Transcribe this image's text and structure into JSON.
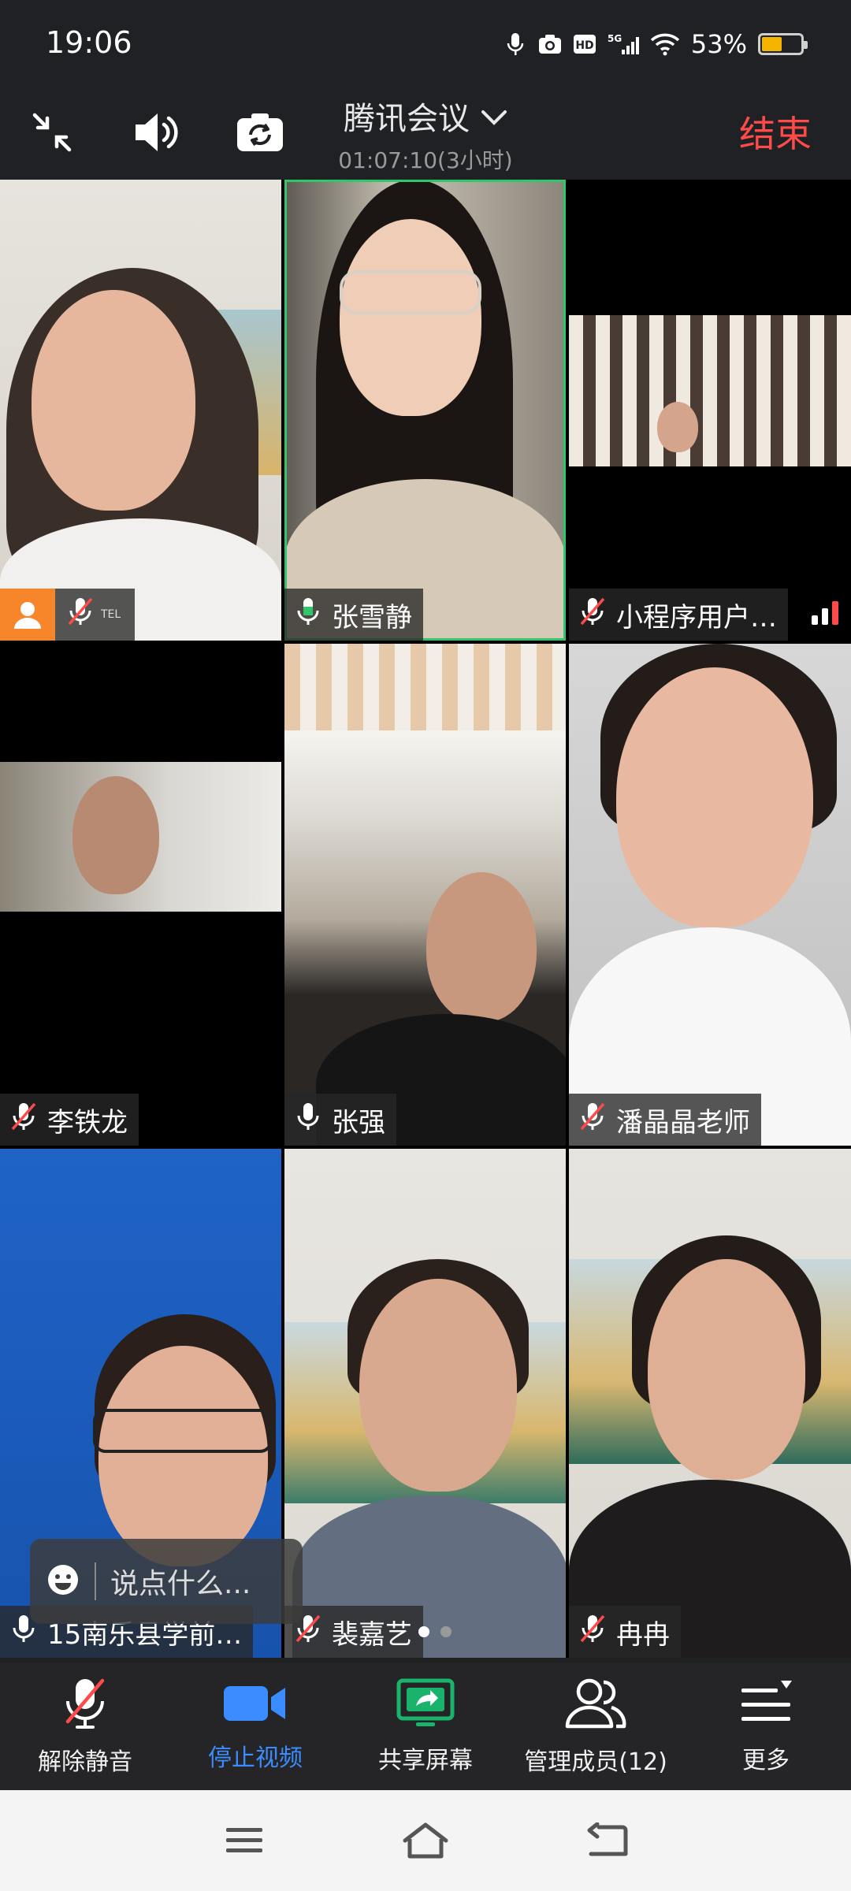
{
  "status_bar": {
    "time": "19:06",
    "network": "5G",
    "battery": "53%",
    "battery_level": 0.53
  },
  "header": {
    "title": "腾讯会议",
    "duration": "01:07:10(3小时)",
    "end_label": "结束"
  },
  "participants": [
    {
      "name": "",
      "tag": "TEL",
      "mic": "muted"
    },
    {
      "name": "张雪静",
      "mic": "on",
      "speaking": true
    },
    {
      "name": "小程序用户…",
      "mic": "muted"
    },
    {
      "name": "李铁龙",
      "mic": "muted"
    },
    {
      "name": "张强",
      "mic": "on"
    },
    {
      "name": "潘晶晶老师",
      "mic": "muted"
    },
    {
      "name": "15南乐县学前…",
      "mic": "on"
    },
    {
      "name": "裴嘉艺",
      "mic": "muted"
    },
    {
      "name": "冉冉",
      "mic": "muted"
    }
  ],
  "chat": {
    "placeholder": "说点什么..."
  },
  "toolbar": {
    "unmute": "解除静音",
    "stop_video": "停止视频",
    "share_screen": "共享屏幕",
    "manage_members": "管理成员(12)",
    "more": "更多"
  },
  "colors": {
    "accent": "#3b8cff",
    "end": "#ff4a4a",
    "speaking_border": "#2fc76a",
    "share_green": "#19b36b"
  }
}
